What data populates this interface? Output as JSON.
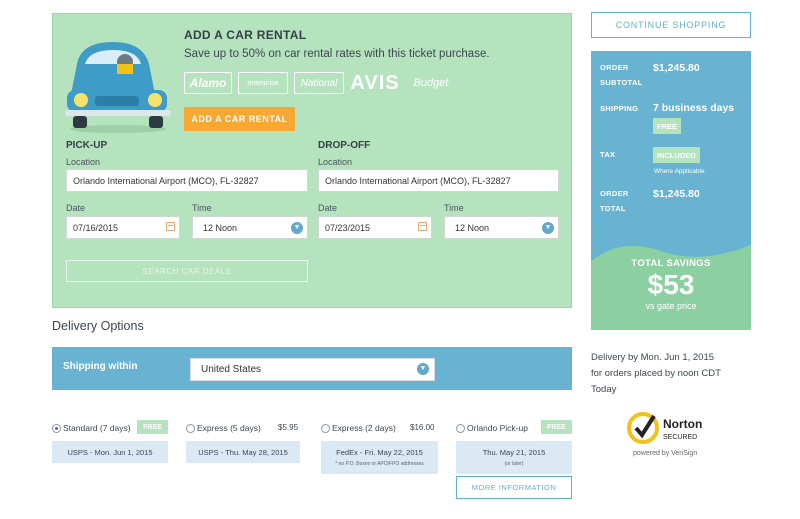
{
  "rental": {
    "title": "ADD A CAR RENTAL",
    "subtitle": "Save up to 50% on car rental rates with this ticket purchase.",
    "brands": [
      "Alamo",
      "enterprise",
      "National",
      "AVIS",
      "Budget"
    ],
    "add_button": "ADD A CAR RENTAL",
    "pickup": {
      "heading": "PICK-UP",
      "location_label": "Location",
      "location_value": "Orlando International Airport (MCO), FL-32827",
      "date_label": "Date",
      "date_value": "07/16/2015",
      "time_label": "Time",
      "time_value": "12 Noon"
    },
    "dropoff": {
      "heading": "DROP-OFF",
      "location_label": "Location",
      "location_value": "Orlando International Airport (MCO), FL-32827",
      "date_label": "Date",
      "date_value": "07/23/2015",
      "time_label": "Time",
      "time_value": "12 Noon"
    },
    "search_button": "SEARCH CAR DEALS"
  },
  "continue_button": "CONTINUE SHOPPING",
  "summary": {
    "subtotal_label_1": "ORDER",
    "subtotal_label_2": "SUBTOTAL",
    "subtotal_value": "$1,245.80",
    "shipping_label": "SHIPPING",
    "shipping_value": "7 business days",
    "shipping_badge": "FREE",
    "tax_label": "TAX",
    "tax_badge": "INCLUDED",
    "tax_note": "Where Applicable",
    "total_label_1": "ORDER",
    "total_label_2": "TOTAL",
    "total_value": "$1,245.80",
    "savings_title": "TOTAL SAVINGS",
    "savings_amount": "$53",
    "savings_sub": "vs gate price"
  },
  "delivery": {
    "title": "Delivery Options",
    "shipping_within_label": "Shipping within",
    "country": "United States",
    "note_line1": "Delivery by Mon. Jun 1, 2015",
    "note_line2": "for orders placed by noon CDT",
    "note_line3": "Today",
    "options": [
      {
        "label": "Standard (7 days)",
        "price": "FREE",
        "box": "USPS - Mon. Jun 1, 2015",
        "selected": true
      },
      {
        "label": "Express (5 days)",
        "price": "$5.95",
        "box": "USPS - Thu. May 28, 2015",
        "selected": false
      },
      {
        "label": "Express (2 days)",
        "price": "$16.00",
        "box": "FedEx - Fri. May 22, 2015",
        "box_note": "* no P.O. Boxes or APO/FPO addresses",
        "selected": false
      },
      {
        "label": "Orlando Pick-up",
        "price": "FREE",
        "box": "Thu. May 21, 2015",
        "box_note": "(or later)",
        "selected": false
      }
    ],
    "more_info_button": "MORE INFORMATION"
  },
  "norton": {
    "name": "Norton",
    "secured": "SECURED",
    "powered_by": "powered by VeriSign"
  },
  "colors": {
    "green_panel": "#b5e3bd",
    "blue_accent": "#67b3d1",
    "orange_button": "#f6a832",
    "light_blue_box": "#dbe9f5"
  }
}
